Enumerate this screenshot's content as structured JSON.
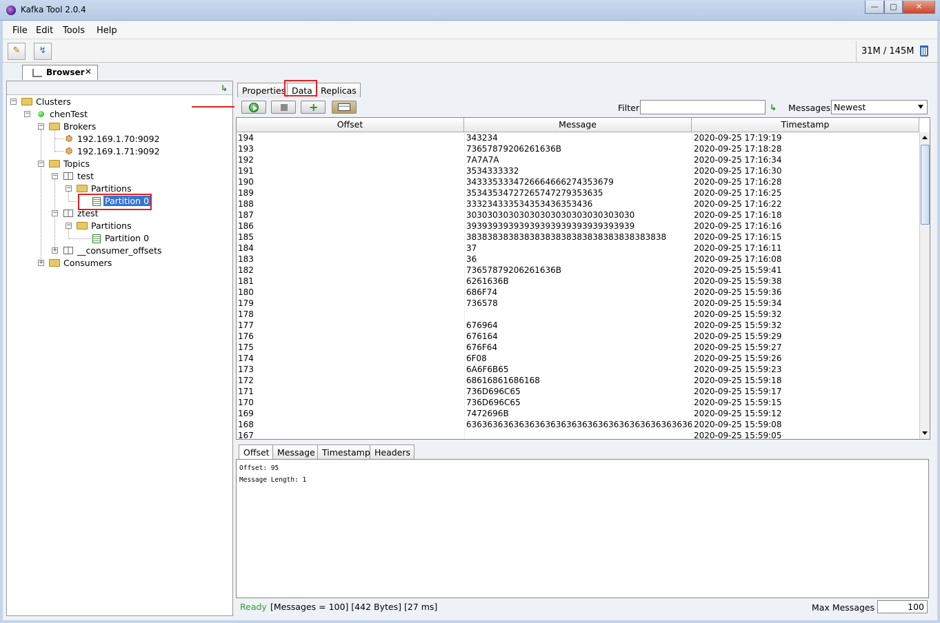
{
  "window": {
    "title": "Kafka Tool  2.0.4"
  },
  "menu": {
    "items": [
      "File",
      "Edit",
      "Tools",
      "Help"
    ]
  },
  "toolbar": {
    "memory": "31M / 145M"
  },
  "tabs": {
    "browser": "Browser"
  },
  "tree": {
    "clusters": "Clusters",
    "cluster": "chenTest",
    "brokers": "Brokers",
    "broker1": "192.169.1.70:9092",
    "broker2": "192.169.1.71:9092",
    "topics": "Topics",
    "topic1": "test",
    "partitions1": "Partitions",
    "partition1": "Partition 0",
    "topic2": "ztest",
    "partitions2": "Partitions",
    "partition2": "Partition 0",
    "topic3": "__consumer_offsets",
    "consumers": "Consumers"
  },
  "right_tabs": [
    "Properties",
    "Data",
    "Replicas"
  ],
  "filter": {
    "label": "Filter",
    "value": ""
  },
  "messages_select": {
    "label": "Messages",
    "value": "Newest"
  },
  "table": {
    "headers": [
      "Offset",
      "Message",
      "Timestamp"
    ],
    "rows": [
      [
        "194",
        "343234",
        "2020-09-25 17:19:19"
      ],
      [
        "193",
        "73657879206261636B",
        "2020-09-25 17:18:28"
      ],
      [
        "192",
        "7A7A7A",
        "2020-09-25 17:16:34"
      ],
      [
        "191",
        "3534333332",
        "2020-09-25 17:16:30"
      ],
      [
        "190",
        "3433353334726664666274353679",
        "2020-09-25 17:16:28"
      ],
      [
        "189",
        "3534353472726574727935363​5",
        "2020-09-25 17:16:25"
      ],
      [
        "188",
        "3332343335343534363​53436",
        "2020-09-25 17:16:22"
      ],
      [
        "187",
        "30303030303030303030303030303030",
        "2020-09-25 17:16:18"
      ],
      [
        "186",
        "39393939393939393939393939393939",
        "2020-09-25 17:16:16"
      ],
      [
        "185",
        "38383838383838383838383838383838383838",
        "2020-09-25 17:16:15"
      ],
      [
        "184",
        "37",
        "2020-09-25 17:16:11"
      ],
      [
        "183",
        "36",
        "2020-09-25 17:16:08"
      ],
      [
        "182",
        "73657879206261636B",
        "2020-09-25 15:59:41"
      ],
      [
        "181",
        "6261636B",
        "2020-09-25 15:59:38"
      ],
      [
        "180",
        "686F74",
        "2020-09-25 15:59:36"
      ],
      [
        "179",
        "736578",
        "2020-09-25 15:59:34"
      ],
      [
        "178",
        "",
        "2020-09-25 15:59:32"
      ],
      [
        "177",
        "676964",
        "2020-09-25 15:59:32"
      ],
      [
        "176",
        "676164",
        "2020-09-25 15:59:29"
      ],
      [
        "175",
        "676F64",
        "2020-09-25 15:59:27"
      ],
      [
        "174",
        "6F08",
        "2020-09-25 15:59:26"
      ],
      [
        "173",
        "6A6F6B65",
        "2020-09-25 15:59:23"
      ],
      [
        "172",
        "68616861686168",
        "2020-09-25 15:59:18"
      ],
      [
        "171",
        "736D696C65",
        "2020-09-25 15:59:17"
      ],
      [
        "170",
        "736D696C65",
        "2020-09-25 15:59:15"
      ],
      [
        "169",
        "7472696B",
        "2020-09-25 15:59:12"
      ],
      [
        "168",
        "6363636363636363636363636363636363636363636...",
        "2020-09-25 15:59:08"
      ],
      [
        "167",
        "",
        "2020-09-25 15:59:05"
      ]
    ]
  },
  "detail_tabs": [
    "Offset",
    "Message",
    "Timestamp",
    "Headers"
  ],
  "detail": {
    "line1": "Offset: 95",
    "line2": "Message Length: 1"
  },
  "status": {
    "ready": "Ready",
    "info": "[Messages = 100]  [442 Bytes]  [27 ms]",
    "max_label": "Max Messages",
    "max_value": "100"
  }
}
